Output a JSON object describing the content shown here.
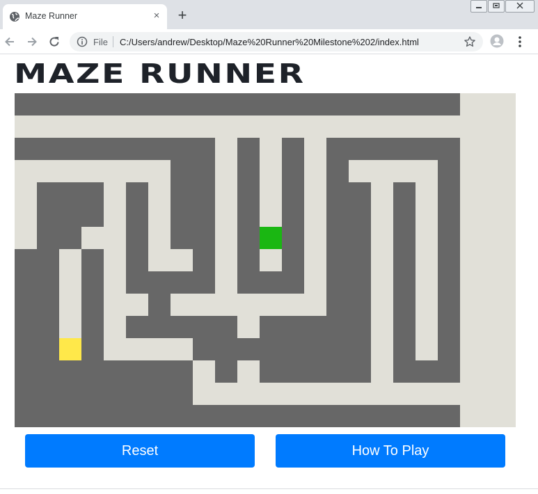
{
  "browser": {
    "tab_title": "Maze Runner",
    "tab_close": "×",
    "new_tab": "+",
    "scheme_label": "File",
    "url": "C:/Users/andrew/Desktop/Maze%20Runner%20Milestone%202/index.html",
    "icons": [
      "globe-icon",
      "close-icon",
      "plus-icon",
      "minimize-icon",
      "restore-icon",
      "window-close-icon",
      "back-arrow-icon",
      "forward-arrow-icon",
      "reload-icon",
      "info-icon",
      "star-icon",
      "avatar-icon",
      "menu-dots-icon"
    ]
  },
  "page": {
    "title": "MAZE RUNNER"
  },
  "maze": {
    "columns": 22,
    "rows": 15,
    "grid": [
      "WWWWWWWWWWWWWWWWWWWW..",
      "......................",
      "WWWWWWWWW.W.W.WWWWWW..",
      ".......WW.W.W.W....W..",
      ".WWW.W.WW.W.W.WW.W.W..",
      ".WWW.W.WW.W.W.WW.W.W..",
      ".WW..W.WW.WPW.WW.W.W..",
      "WW.W.W..W.W.W.WW.W.W..",
      "WW.W.WWWW.WWW.WW.W.W..",
      "WW.W..W.......WW.W.W..",
      "WW.W.WWWWW.WWWWW.W.W..",
      "WWGW....WWWWWWWW.W.W..",
      "WWWWWWWW.W.WWWWW.WWW..",
      "WWWWWWWW..............",
      "WWWWWWWWWWWWWWWWWWWW.."
    ],
    "colors": {
      "wall": "#676767",
      "path": "#e1e0d8",
      "player": "#1ab712",
      "goal": "#ffe84a"
    }
  },
  "buttons": {
    "reset": "Reset",
    "how_to_play": "How To Play",
    "color": "#007bff"
  }
}
